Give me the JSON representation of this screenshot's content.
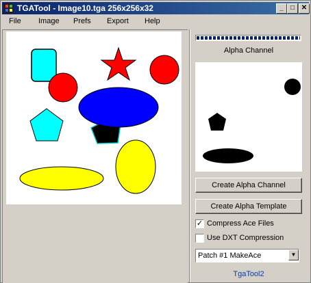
{
  "window": {
    "title": "TGATool - Image10.tga  256x256x32",
    "minimize": "_",
    "maximize": "□",
    "close": "✕"
  },
  "menu": [
    "File",
    "Image",
    "Prefs",
    "Export",
    "Help"
  ],
  "alpha": {
    "label": "Alpha Channel",
    "progress": 1.0
  },
  "buttons": {
    "create_alpha_channel": "Create Alpha Channel",
    "create_alpha_template": "Create Alpha Template"
  },
  "options": {
    "compress_ace": {
      "label": "Compress Ace Files",
      "checked": true
    },
    "use_dxt": {
      "label": "Use DXT Compression",
      "checked": false
    }
  },
  "patch_select": {
    "value": "Patch #1 MakeAce"
  },
  "footer": "TgaTool2",
  "colors": {
    "cyan": "#00ffff",
    "red": "#ff0000",
    "blue": "#0000ff",
    "yellow": "#ffff00",
    "black": "#000000",
    "titlebar": "#0a246a"
  }
}
